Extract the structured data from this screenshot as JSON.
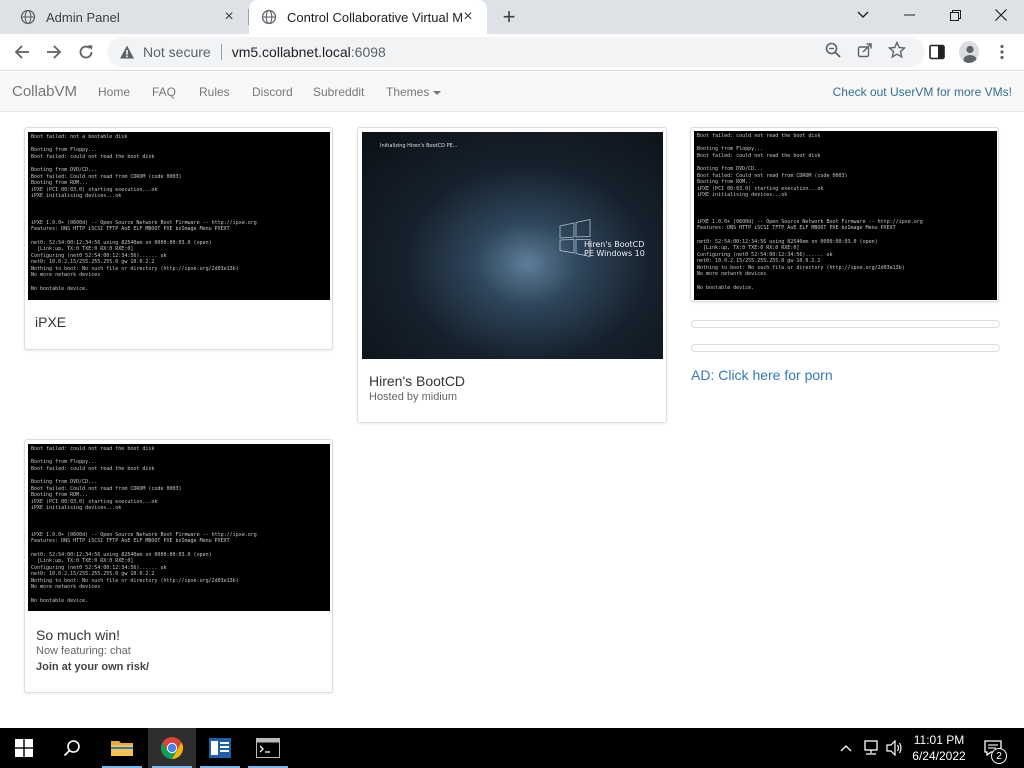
{
  "browser": {
    "tabs": [
      {
        "title": "Admin Panel",
        "active": false
      },
      {
        "title": "Control Collaborative Virtual Ma",
        "active": true
      }
    ],
    "omnibox": {
      "security_label": "Not secure",
      "url_host": "vm5.collabnet.local",
      "url_rest": ":6098"
    }
  },
  "navbar": {
    "brand": "CollabVM",
    "links": [
      "Home",
      "FAQ",
      "Rules",
      "Discord",
      "Subreddit",
      "Themes"
    ],
    "right_link": "Check out UserVM for more VMs!"
  },
  "vms": [
    {
      "title": "iPXE",
      "screen": "ipxe-boot-failed"
    },
    {
      "title": "Hiren's BootCD",
      "subtitle": "Hosted by midium",
      "screen_caption": "Initializing Hiren's BootCD PE...",
      "screen_logo_text": "Hiren's BootCD\nPE Windows 10"
    },
    {
      "title": "So much win!",
      "subtitle": "Now featuring: chat",
      "subtitle2": "Join at your own risk/",
      "screen": "ipxe-boot-failed"
    }
  ],
  "ad": {
    "text": "AD: Click here for porn"
  },
  "terminal": {
    "ipxe_text": "Boot failed: not a bootable disk\n\nBooting from Floppy...\nBoot failed: could not read the boot disk\n\nBooting from DVD/CD...\nBoot failed: Could not read from CDROM (code 0003)\nBooting from ROM...\niPXE (PCI 00:03.0) starting execution...ok\niPXE initialising devices...ok\n\n\n\niPXE 1.0.0+ (0600d) -- Open Source Network Boot Firmware -- http://ipxe.org\nFeatures: DNS HTTP iSCSI TFTP AoE ELF MBOOT PXE bzImage Menu PXEXT\n\nnet0: 52:54:00:12:34:56 using 82540em on 0000:00:03.0 (open)\n  [Link:up, TX:0 TXE:0 RX:0 RXE:0]\nConfiguring (net0 52:54:00:12:34:56)...... ok\nnet0: 10.0.2.15/255.255.255.0 gw 10.0.2.2\nNothing to boot: No such file or directory (http://ipxe.org/2d03e13b)\nNo more network devices\n\nNo bootable device.",
    "vm3_text": "Boot failed: could not read the boot disk\n\nBooting from Floppy...\nBoot failed: could not read the boot disk\n\nBooting from DVD/CD...\nBoot failed: Could not read from CDROM (code 0003)\nBooting from ROM...\niPXE (PCI 00:03.0) starting execution...ok\niPXE initialising devices...ok\n\n\n\niPXE 1.0.0+ (0600d) -- Open Source Network Boot Firmware -- http://ipxe.org\nFeatures: DNS HTTP iSCSI TFTP AoE ELF MBOOT PXE bzImage Menu PXEXT\n\nnet0: 52:54:00:12:34:56 using 82540em on 0000:00:03.0 (open)\n  [Link:up, TX:0 TXE:0 RX:0 RXE:0]\nConfiguring (net0 52:54:00:12:34:56)...... ok\nnet0: 10.0.2.15/255.255.255.0 gw 10.0.2.2\nNothing to boot: No such file or directory (http://ipxe.org/2d03e13b)\nNo more network devices\n\nNo bootable device."
  },
  "taskbar": {
    "apps": [
      "start-button",
      "search",
      "file-explorer",
      "chrome",
      "server-manager",
      "command-prompt"
    ],
    "clock_time": "11:01 PM",
    "clock_date": "6/24/2022",
    "notification_count": "2"
  },
  "colors": {
    "link": "#337ab7",
    "userVM_link": "#31708f",
    "taskbar": "#000000",
    "tabstrip": "#dee1e6"
  }
}
